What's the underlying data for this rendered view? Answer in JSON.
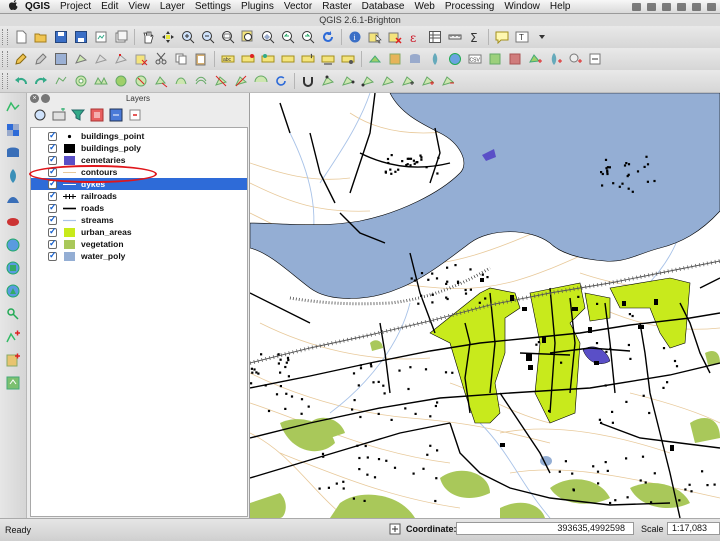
{
  "menubar": {
    "apple": "",
    "items": [
      "QGIS",
      "Project",
      "Edit",
      "View",
      "Layer",
      "Settings",
      "Plugins",
      "Vector",
      "Raster",
      "Database",
      "Web",
      "Processing",
      "Window",
      "Help"
    ]
  },
  "window": {
    "title": "QGIS 2.6.1-Brighton"
  },
  "layers_panel": {
    "title": "Layers",
    "layers": [
      {
        "name": "buildings_point",
        "symbol": "point",
        "checked": true,
        "selected": false
      },
      {
        "name": "buildings_poly",
        "symbol": "black-fill",
        "checked": true,
        "selected": false
      },
      {
        "name": "cemetaries",
        "symbol": "purple-fill",
        "checked": true,
        "selected": false
      },
      {
        "name": "contours",
        "symbol": "tan-line",
        "checked": true,
        "selected": false
      },
      {
        "name": "dykes",
        "symbol": "line",
        "checked": true,
        "selected": true
      },
      {
        "name": "railroads",
        "symbol": "rail-line",
        "checked": true,
        "selected": false
      },
      {
        "name": "roads",
        "symbol": "black-line",
        "checked": true,
        "selected": false
      },
      {
        "name": "streams",
        "symbol": "blue-line",
        "checked": true,
        "selected": false
      },
      {
        "name": "urban_areas",
        "symbol": "yellowgreen-fill",
        "checked": true,
        "selected": false
      },
      {
        "name": "vegetation",
        "symbol": "green-fill",
        "checked": true,
        "selected": false
      },
      {
        "name": "water_poly",
        "symbol": "blue-fill",
        "checked": true,
        "selected": false
      }
    ],
    "highlighted_layer": "contours"
  },
  "colors": {
    "water": "#94aed4",
    "urban": "#c8ea1c",
    "vegetation": "#a9c85a",
    "cemetary": "#5a4fc7",
    "contour": "#e8c99a",
    "stream": "#a9c3e8",
    "selection": "#2e6bd8",
    "annotation": "#e0161b"
  },
  "toolbar_icons": [
    "new-project-icon",
    "open-icon",
    "save-icon",
    "save-as-icon",
    "print-composer-icon",
    "composer-manager-icon",
    "pan-icon",
    "pan-to-selection-icon",
    "zoom-in-icon",
    "zoom-out-icon",
    "zoom-full-icon",
    "zoom-selection-icon",
    "zoom-layer-icon",
    "zoom-last-icon",
    "zoom-next-icon",
    "refresh-icon",
    "identify-icon",
    "select-icon",
    "deselect-icon",
    "field-calculator-icon",
    "attribute-table-icon",
    "measure-icon",
    "statistics-icon",
    "annotation-icon",
    "text-annotation-icon"
  ],
  "status": {
    "ready": "Ready",
    "coordinate_label": "Coordinate:",
    "coordinate_value": "393635,4992598",
    "scale_label": "Scale",
    "scale_value": "1:17,083"
  }
}
